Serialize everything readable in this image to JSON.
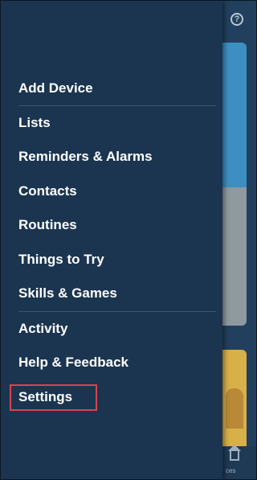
{
  "background": {
    "help_icon": "?",
    "bottom_label": "ces"
  },
  "menu": {
    "items": [
      {
        "id": "add-device",
        "label": "Add Device"
      },
      {
        "id": "lists",
        "label": "Lists"
      },
      {
        "id": "reminders-alarms",
        "label": "Reminders & Alarms"
      },
      {
        "id": "contacts",
        "label": "Contacts"
      },
      {
        "id": "routines",
        "label": "Routines"
      },
      {
        "id": "things-to-try",
        "label": "Things to Try"
      },
      {
        "id": "skills-games",
        "label": "Skills & Games"
      },
      {
        "id": "activity",
        "label": "Activity"
      },
      {
        "id": "help-feedback",
        "label": "Help & Feedback"
      },
      {
        "id": "settings",
        "label": "Settings"
      }
    ],
    "highlighted_item": "settings"
  },
  "colors": {
    "drawer_bg": "#1b3550",
    "text": "#ffffff",
    "divider": "#3a5672",
    "highlight": "#d9434f"
  }
}
